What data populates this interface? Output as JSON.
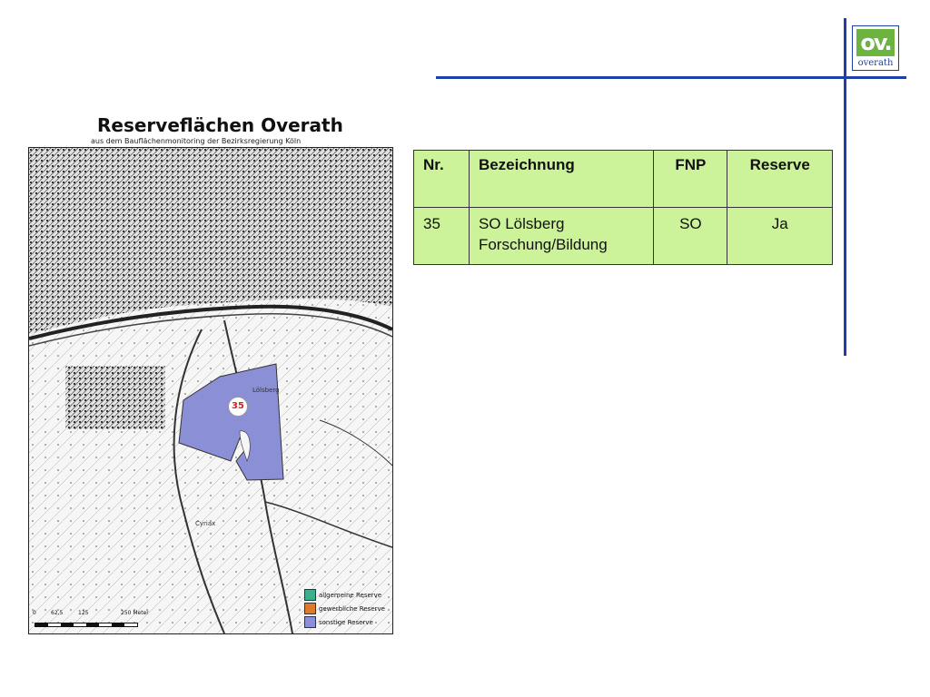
{
  "logo": {
    "mark_text": "ov.",
    "word": "overath",
    "brand_color": "#6db33f",
    "line_color": "#1f3fa8"
  },
  "map": {
    "title": "Reserveflächen Overath",
    "subtitle": "aus dem Bauflächenmonitoring der Bezirksregierung Köln",
    "marker_label": "35",
    "place_labels": [
      "Lölsberg",
      "Cyriax"
    ],
    "reserve_color": "#8a8fd6",
    "legend": [
      {
        "label": "allgemeine Reserve",
        "color": "#3fae8c"
      },
      {
        "label": "gewerbliche Reserve",
        "color": "#e07a2a"
      },
      {
        "label": "sonstige Reserve",
        "color": "#8a8fd6"
      }
    ],
    "scale": {
      "ticks": [
        "0",
        "62,5",
        "125",
        "250 Meter"
      ]
    }
  },
  "table": {
    "headers": [
      "Nr.",
      "Bezeichnung",
      "FNP",
      "Reserve"
    ],
    "rows": [
      {
        "nr": "35",
        "bezeichnung_line1": "SO Lölsberg",
        "bezeichnung_line2": "Forschung/Bildung",
        "fnp": "SO",
        "reserve": "Ja"
      }
    ],
    "background": "#ccf29a"
  }
}
